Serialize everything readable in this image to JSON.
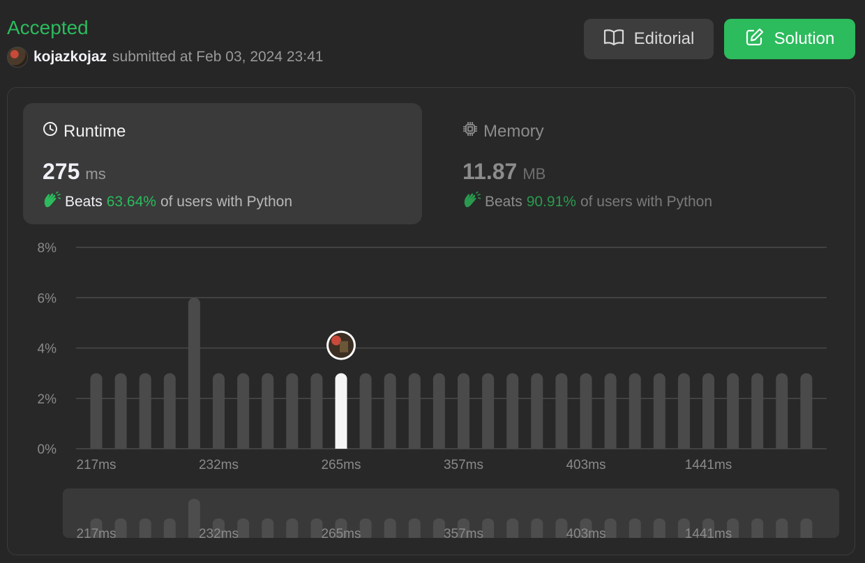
{
  "header": {
    "status": "Accepted",
    "username": "kojazkojaz",
    "submitted_text": "submitted at Feb 03, 2024 23:41"
  },
  "buttons": {
    "editorial": "Editorial",
    "solution": "Solution"
  },
  "runtime": {
    "label": "Runtime",
    "value": "275",
    "unit": "ms",
    "beats_prefix": "Beats",
    "beats_pct": "63.64%",
    "beats_suffix": "of users with Python"
  },
  "memory": {
    "label": "Memory",
    "value": "11.87",
    "unit": "MB",
    "beats_prefix": "Beats",
    "beats_pct": "90.91%",
    "beats_suffix": "of users with Python"
  },
  "colors": {
    "accent_green": "#2cbb5d",
    "bar": "#4a4a4a",
    "bar_highlight": "#f5f5f5",
    "grid": "#4a4a4a"
  },
  "chart_data": {
    "type": "bar",
    "ylabel": "",
    "xlabel": "",
    "ylim": [
      0,
      8
    ],
    "y_ticks": [
      "0%",
      "2%",
      "4%",
      "6%",
      "8%"
    ],
    "y_tick_values": [
      0,
      2,
      4,
      6,
      8
    ],
    "x_tick_labels": [
      "217ms",
      "232ms",
      "265ms",
      "357ms",
      "403ms",
      "1441ms"
    ],
    "x_tick_bar_index": [
      0,
      5,
      10,
      15,
      20,
      25
    ],
    "values": [
      3,
      3,
      3,
      3,
      6,
      3,
      3,
      3,
      3,
      3,
      3,
      3,
      3,
      3,
      3,
      3,
      3,
      3,
      3,
      3,
      3,
      3,
      3,
      3,
      3,
      3,
      3,
      3,
      3,
      3
    ],
    "highlight_index": 10,
    "highlight_marker": "user-avatar"
  }
}
